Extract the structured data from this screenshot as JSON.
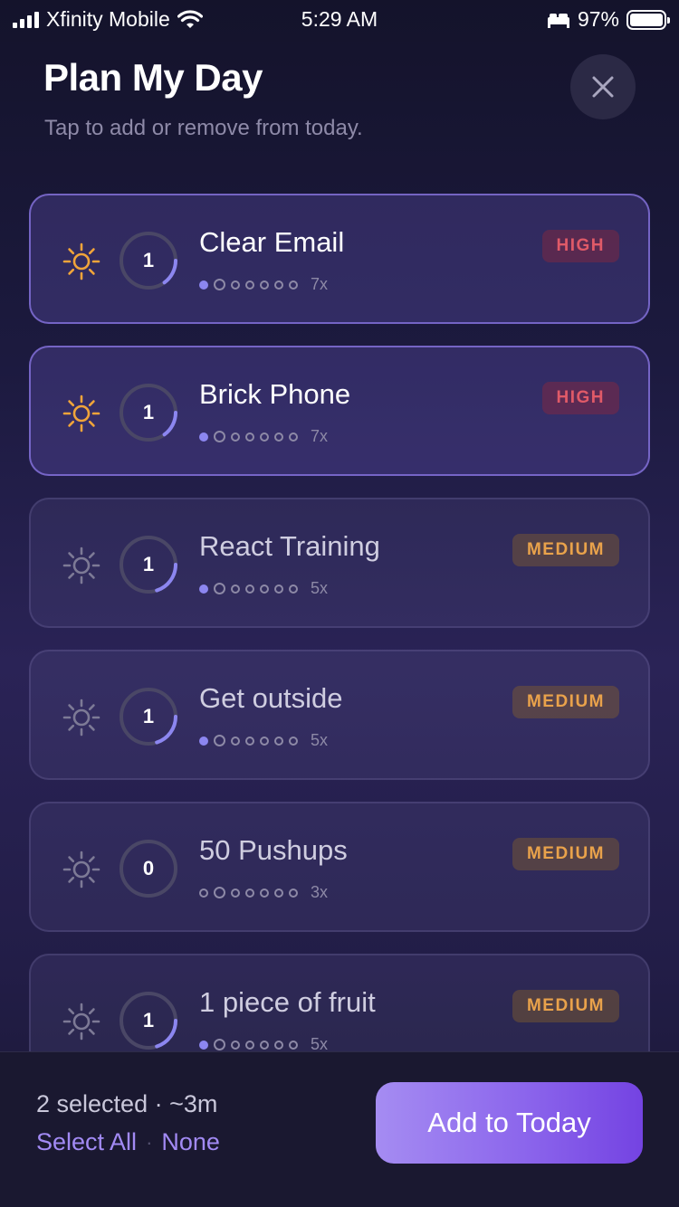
{
  "status_bar": {
    "carrier": "Xfinity Mobile",
    "time": "5:29 AM",
    "battery": "97%"
  },
  "header": {
    "title": "Plan My Day",
    "subtitle": "Tap to add or remove from today.",
    "close_icon": "close-icon"
  },
  "tasks": [
    {
      "name": "Clear Email",
      "count": "1",
      "priority": "HIGH",
      "frequency": "7x",
      "selected": true,
      "progress": 0.15,
      "dots_filled": 1,
      "dots_total": 7
    },
    {
      "name": "Brick Phone",
      "count": "1",
      "priority": "HIGH",
      "frequency": "7x",
      "selected": true,
      "progress": 0.15,
      "dots_filled": 1,
      "dots_total": 7
    },
    {
      "name": "React Training",
      "count": "1",
      "priority": "MEDIUM",
      "frequency": "5x",
      "selected": false,
      "progress": 0.2,
      "dots_filled": 1,
      "dots_total": 7
    },
    {
      "name": "Get outside",
      "count": "1",
      "priority": "MEDIUM",
      "frequency": "5x",
      "selected": false,
      "progress": 0.2,
      "dots_filled": 1,
      "dots_total": 7
    },
    {
      "name": "50 Pushups",
      "count": "0",
      "priority": "MEDIUM",
      "frequency": "3x",
      "selected": false,
      "progress": 0,
      "dots_filled": 0,
      "dots_total": 7
    },
    {
      "name": "1 piece of fruit",
      "count": "1",
      "priority": "MEDIUM",
      "frequency": "5x",
      "selected": false,
      "progress": 0.2,
      "dots_filled": 1,
      "dots_total": 7
    }
  ],
  "footer": {
    "summary": "2 selected · ~3m",
    "select_all": "Select All",
    "separator": "·",
    "none": "None",
    "add_button": "Add to Today"
  },
  "colors": {
    "accent": "#8c86f0",
    "sun_active": "#f0a43a",
    "sun_inactive": "#7d7a96",
    "high": "#e05a68",
    "medium": "#e9a24b"
  }
}
